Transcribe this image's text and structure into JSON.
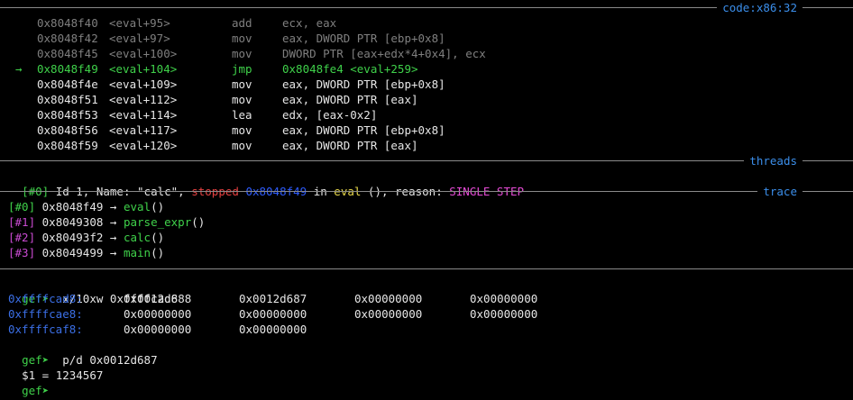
{
  "sections": {
    "code": "code:x86:32",
    "threads": "threads",
    "trace": "trace"
  },
  "code": [
    {
      "marker": "",
      "addr": "0x8048f40",
      "sym": "<eval+95>",
      "mnem": "add",
      "ops": "ecx, eax",
      "style": "dim"
    },
    {
      "marker": "",
      "addr": "0x8048f42",
      "sym": "<eval+97>",
      "mnem": "mov",
      "ops": "eax, DWORD PTR [ebp+0x8]",
      "style": "dim"
    },
    {
      "marker": "",
      "addr": "0x8048f45",
      "sym": "<eval+100>",
      "mnem": "mov",
      "ops": "DWORD PTR [eax+edx*4+0x4], ecx",
      "style": "dim"
    },
    {
      "marker": "→",
      "addr": "0x8048f49",
      "sym": "<eval+104>",
      "mnem": "jmp",
      "ops": "0x8048fe4 <eval+259>",
      "style": "current"
    },
    {
      "marker": "",
      "addr": "0x8048f4e",
      "sym": "<eval+109>",
      "mnem": "mov",
      "ops": "eax, DWORD PTR [ebp+0x8]",
      "style": "normal"
    },
    {
      "marker": "",
      "addr": "0x8048f51",
      "sym": "<eval+112>",
      "mnem": "mov",
      "ops": "eax, DWORD PTR [eax]",
      "style": "normal"
    },
    {
      "marker": "",
      "addr": "0x8048f53",
      "sym": "<eval+114>",
      "mnem": "lea",
      "ops": "edx, [eax-0x2]",
      "style": "normal"
    },
    {
      "marker": "",
      "addr": "0x8048f56",
      "sym": "<eval+117>",
      "mnem": "mov",
      "ops": "eax, DWORD PTR [ebp+0x8]",
      "style": "normal"
    },
    {
      "marker": "",
      "addr": "0x8048f59",
      "sym": "<eval+120>",
      "mnem": "mov",
      "ops": "eax, DWORD PTR [eax]",
      "style": "normal"
    }
  ],
  "thread": {
    "index": "[#0]",
    "id_text": " Id 1, Name: ",
    "name": "\"calc\"",
    "sep": ", ",
    "state": "stopped",
    "addr": "0x8048f49",
    "in_text": " in ",
    "func": "eval",
    "after_func": " (), reason: ",
    "reason": "SINGLE STEP"
  },
  "trace": [
    {
      "index": "[#0]",
      "addr": "0x8048f49",
      "func": "eval",
      "suffix": "()"
    },
    {
      "index": "[#1]",
      "addr": "0x8049308",
      "func": "parse_expr",
      "suffix": "()"
    },
    {
      "index": "[#2]",
      "addr": "0x80493f2",
      "func": "calc",
      "suffix": "()"
    },
    {
      "index": "[#3]",
      "addr": "0x8049499",
      "func": "main",
      "suffix": "()"
    }
  ],
  "trace_arrow": "→",
  "console": {
    "prompt": "gef➤",
    "cmd1": "x/10xw 0xffffcad8",
    "memory": [
      {
        "addr": "0xffffcad8:",
        "words": [
          "0x0012d688",
          "0x0012d687",
          "0x00000000",
          "0x00000000"
        ]
      },
      {
        "addr": "0xffffcae8:",
        "words": [
          "0x00000000",
          "0x00000000",
          "0x00000000",
          "0x00000000"
        ]
      },
      {
        "addr": "0xffffcaf8:",
        "words": [
          "0x00000000",
          "0x00000000"
        ]
      }
    ],
    "cmd2": "p/d 0x0012d687",
    "result": "$1 = 1234567"
  }
}
